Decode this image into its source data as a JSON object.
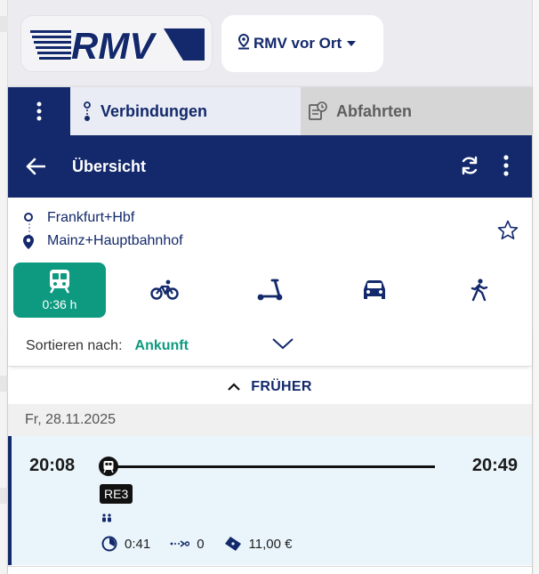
{
  "top": {
    "logo_text": "RMV",
    "vorort_label": "RMV vor Ort"
  },
  "tabs": [
    {
      "label": "Verbindungen",
      "active": true,
      "icon": "route-icon"
    },
    {
      "label": "Abfahrten",
      "active": false,
      "icon": "departures-icon"
    }
  ],
  "header": {
    "title": "Übersicht",
    "icons": [
      "back-arrow-icon",
      "refresh-icon",
      "more-vertical-icon"
    ]
  },
  "route": {
    "from": "Frankfurt+Hbf",
    "to": "Mainz+Hauptbahnhof"
  },
  "modes": [
    {
      "name": "train",
      "icon": "train-icon",
      "active": true,
      "duration": "0:36 h"
    },
    {
      "name": "bike",
      "icon": "bicycle-icon",
      "active": false
    },
    {
      "name": "scooter",
      "icon": "scooter-icon",
      "active": false
    },
    {
      "name": "car",
      "icon": "car-icon",
      "active": false
    },
    {
      "name": "walk",
      "icon": "walk-icon",
      "active": false
    }
  ],
  "sort": {
    "label": "Sortieren nach:",
    "value": "Ankunft"
  },
  "earlier_label": "FRÜHER",
  "date": "Fr, 28.11.2025",
  "connection": {
    "departure": "20:08",
    "arrival": "20:49",
    "line": "RE3",
    "duration": "0:41",
    "changes": "0",
    "price": "11,00 €"
  },
  "colors": {
    "navy": "#13296b",
    "green": "#0e9a80",
    "conn_bg": "#eaf5fb"
  }
}
